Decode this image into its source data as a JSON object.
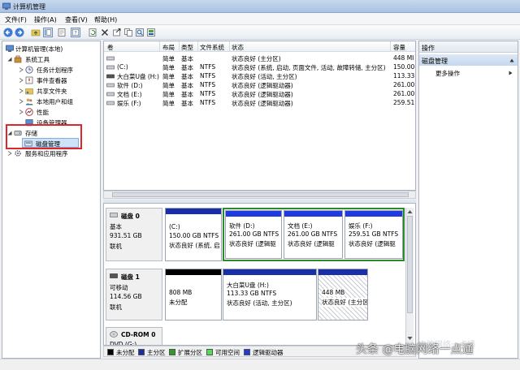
{
  "window": {
    "title": "计算机管理"
  },
  "menu": [
    "文件(F)",
    "操作(A)",
    "查看(V)",
    "帮助(H)"
  ],
  "tree": {
    "root": "计算机管理(本地)",
    "system_tools": "系统工具",
    "task_scheduler": "任务计划程序",
    "event_viewer": "事件查看器",
    "shared_folders": "共享文件夹",
    "local_users": "本地用户和组",
    "performance": "性能",
    "device_manager": "设备管理器",
    "storage": "存储",
    "disk_management": "磁盘管理",
    "services": "服务和应用程序"
  },
  "volume_list": {
    "headers": [
      "卷",
      "布局",
      "类型",
      "文件系统",
      "状态",
      "容量"
    ],
    "rows": [
      [
        "",
        "简单",
        "基本",
        "",
        "状态良好 (主分区)",
        "448 MI"
      ],
      [
        "(C:)",
        "简单",
        "基本",
        "NTFS",
        "状态良好 (系统, 启动, 页面文件, 活动, 故障转储, 主分区)",
        "150.00"
      ],
      [
        "大白菜U盘 (H:)",
        "简单",
        "基本",
        "NTFS",
        "状态良好 (活动, 主分区)",
        "113.33"
      ],
      [
        "软件 (D:)",
        "简单",
        "基本",
        "NTFS",
        "状态良好 (逻辑驱动器)",
        "261.00"
      ],
      [
        "文档 (E:)",
        "简单",
        "基本",
        "NTFS",
        "状态良好 (逻辑驱动器)",
        "261.00"
      ],
      [
        "娱乐 (F:)",
        "简单",
        "基本",
        "NTFS",
        "状态良好 (逻辑驱动器)",
        "259.51"
      ]
    ]
  },
  "disks": [
    {
      "name": "磁盘 0",
      "kind": "基本",
      "size": "931.51 GB",
      "state": "联机",
      "partitions": [
        {
          "title": "(C:)",
          "size": "150.00 GB NTFS",
          "status": "状态良好 (系统, 启"
        },
        {
          "title": "软件  (D:)",
          "size": "261.00 GB NTFS",
          "status": "状态良好 (逻辑驱"
        },
        {
          "title": "文档  (E:)",
          "size": "261.00 GB NTFS",
          "status": "状态良好 (逻辑驱"
        },
        {
          "title": "娱乐  (F:)",
          "size": "259.51 GB NTFS",
          "status": "状态良好 (逻辑驱"
        }
      ]
    },
    {
      "name": "磁盘 1",
      "kind": "可移动",
      "size": "114.56 GB",
      "state": "联机",
      "partitions": [
        {
          "title": "",
          "size": "808 MB",
          "status": "未分配"
        },
        {
          "title": "大白菜U盘  (H:)",
          "size": "113.33 GB NTFS",
          "status": "状态良好 (活动, 主分区)"
        },
        {
          "title": "",
          "size": "448 MB",
          "status": "状态良好 (主分区)"
        }
      ]
    },
    {
      "name": "CD-ROM 0",
      "kind": "DVD (G:)"
    }
  ],
  "legend": [
    "未分配",
    "主分区",
    "扩展分区",
    "可用空间",
    "逻辑驱动器"
  ],
  "colors": {
    "unallocated": "#000000",
    "primary": "#1a2ea6",
    "extended": "#2e9a2e",
    "free": "#4fe04f",
    "logical": "#1f3ae0",
    "highlight_box": "#e0262b"
  },
  "actions": {
    "header": "操作",
    "selected": "磁盘管理",
    "more": "更多操作"
  },
  "watermark": {
    "text": "头条 @电脑网络一点通",
    "faint": "电脑网络一点通"
  }
}
